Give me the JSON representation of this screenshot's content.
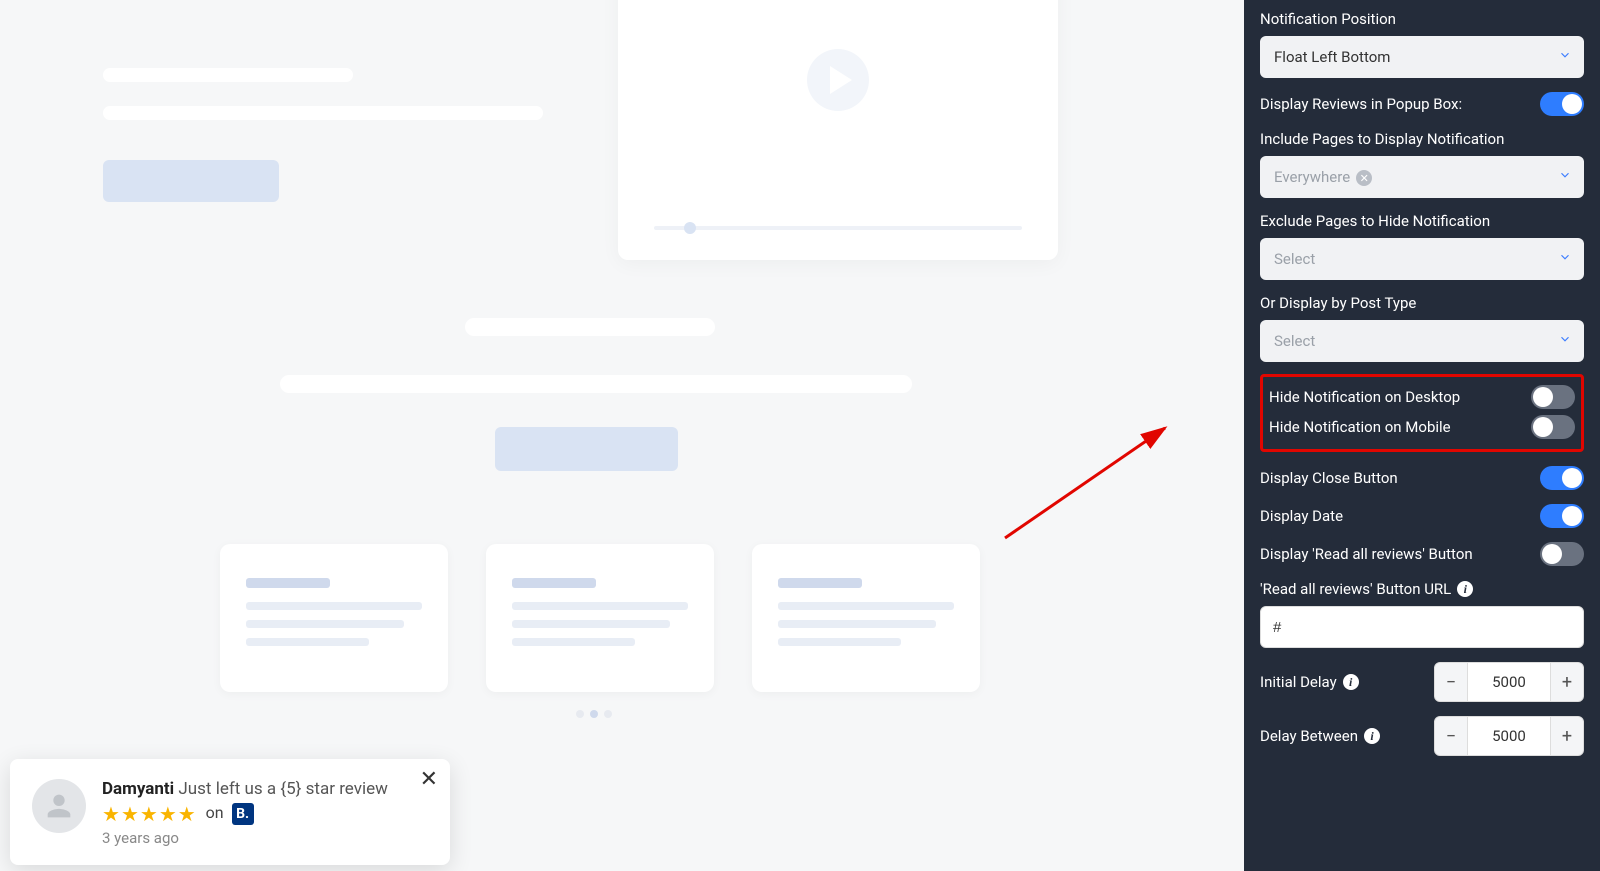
{
  "sidebar": {
    "position_label": "Notification Position",
    "position_value": "Float Left Bottom",
    "display_popup_label": "Display Reviews in Popup Box:",
    "display_popup_on": true,
    "include_label": "Include Pages to Display Notification",
    "include_value": "Everywhere",
    "exclude_label": "Exclude Pages to Hide Notification",
    "exclude_placeholder": "Select",
    "posttype_label": "Or Display by Post Type",
    "posttype_placeholder": "Select",
    "hide_desktop_label": "Hide Notification on Desktop",
    "hide_desktop_on": false,
    "hide_mobile_label": "Hide Notification on Mobile",
    "hide_mobile_on": false,
    "close_btn_label": "Display Close Button",
    "close_btn_on": true,
    "date_label": "Display Date",
    "date_on": true,
    "readall_label": "Display 'Read all reviews' Button",
    "readall_on": false,
    "url_label": "'Read all reviews' Button URL",
    "url_value": "#",
    "initial_delay_label": "Initial Delay",
    "initial_delay_value": "5000",
    "delay_between_label": "Delay Between",
    "delay_between_value": "5000"
  },
  "popup": {
    "name": "Damyanti",
    "tail": " Just left us a {5} star review",
    "on": "on",
    "platform_letter": "B.",
    "date": "3 years ago"
  }
}
